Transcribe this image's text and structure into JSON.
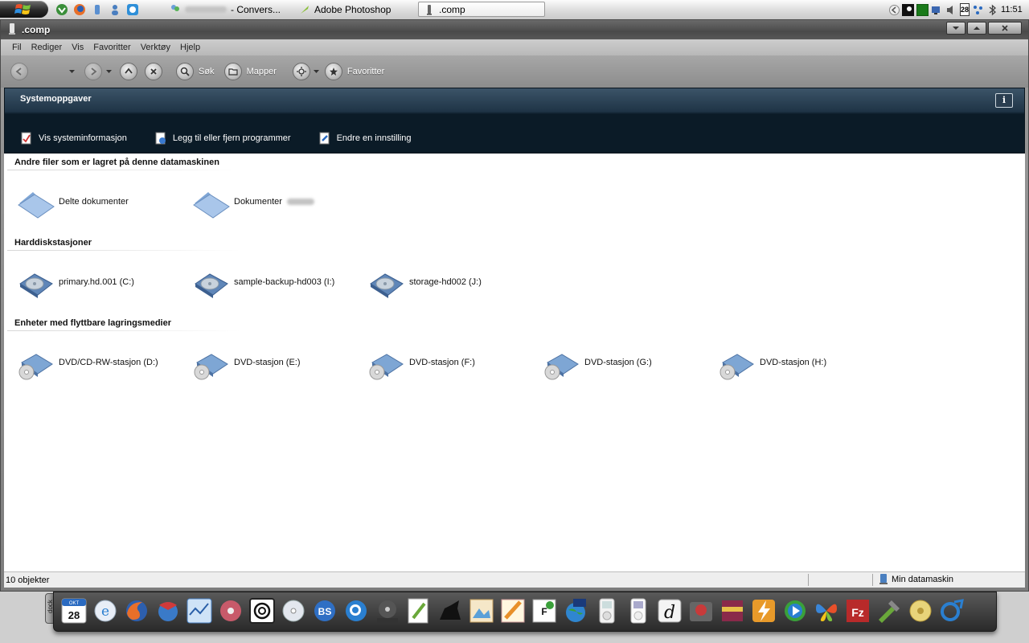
{
  "taskbar": {
    "tasks": [
      {
        "label": "- Convers..."
      },
      {
        "label": "Adobe Photoshop"
      },
      {
        "label": ".comp"
      }
    ],
    "tray_date": "28",
    "clock": "11:51"
  },
  "window": {
    "title": ".comp",
    "menu": [
      "Fil",
      "Rediger",
      "Vis",
      "Favoritter",
      "Verktøy",
      "Hjelp"
    ],
    "toolbar": {
      "search_label": "Søk",
      "folders_label": "Mapper",
      "favorites_label": "Favoritter"
    },
    "system_tasks": {
      "title": "Systemoppgaver",
      "info_glyph": "i",
      "links": [
        {
          "label": "Vis systeminformasjon"
        },
        {
          "label": "Legg til eller fjern programmer"
        },
        {
          "label": "Endre en innstilling"
        }
      ]
    },
    "groups": [
      {
        "heading": "Andre filer som er lagret på denne datamaskinen",
        "items": [
          {
            "label": "Delte dokumenter",
            "icon": "folder-icon"
          },
          {
            "label": "Dokumenter",
            "icon": "folder-icon"
          }
        ]
      },
      {
        "heading": "Harddiskstasjoner",
        "items": [
          {
            "label": "primary.hd.001 (C:)",
            "icon": "hard-drive-icon"
          },
          {
            "label": "sample-backup-hd003 (I:)",
            "icon": "hard-drive-icon"
          },
          {
            "label": "storage-hd002 (J:)",
            "icon": "hard-drive-icon"
          }
        ]
      },
      {
        "heading": "Enheter med flyttbare lagringsmedier",
        "items": [
          {
            "label": "DVD/CD-RW-stasjon (D:)",
            "icon": "dvd-drive-icon"
          },
          {
            "label": "DVD-stasjon (E:)",
            "icon": "dvd-drive-icon"
          },
          {
            "label": "DVD-stasjon (F:)",
            "icon": "dvd-drive-icon"
          },
          {
            "label": "DVD-stasjon (G:)",
            "icon": "dvd-drive-icon"
          },
          {
            "label": "DVD-stasjon (H:)",
            "icon": "dvd-drive-icon"
          }
        ]
      }
    ],
    "status": {
      "count_text": "10 objekter",
      "zone_text": "Min datamaskin"
    }
  },
  "dock": {
    "label": "dock",
    "calendar_day": "28",
    "calendar_month": "OKT"
  }
}
